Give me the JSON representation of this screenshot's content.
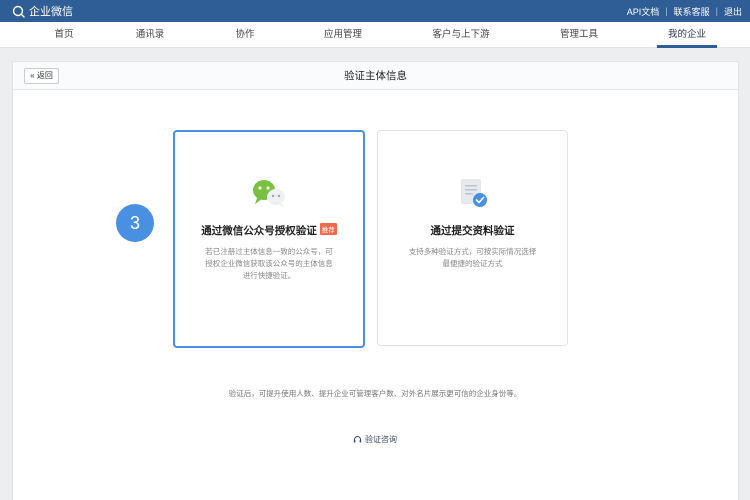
{
  "topbar": {
    "brand_name": "企业微信",
    "links": [
      "API文档",
      "联系客服",
      "退出"
    ],
    "separator": "|"
  },
  "nav": {
    "items": [
      "首页",
      "通讯录",
      "协作",
      "应用管理",
      "客户与上下游",
      "管理工具",
      "我的企业"
    ],
    "active": "我的企业"
  },
  "panel": {
    "back_label": "« 返回",
    "title": "验证主体信息"
  },
  "step_number": "3",
  "options": [
    {
      "title": "通过微信公众号授权验证",
      "badge": "推荐",
      "desc_lines": [
        "若已注册过主体信息一致的公众号，可",
        "授权企业微信获取该公众号的主体信息",
        "进行快捷验证。"
      ],
      "icon": "wechat-icon",
      "selected": true
    },
    {
      "title": "通过提交资料验证",
      "desc_lines": [
        "支持多种验证方式，可按实际情况选择",
        "最便捷的验证方式"
      ],
      "icon": "document-check-icon",
      "selected": false
    }
  ],
  "footer_note": "验证后，可提升使用人数、提升企业可管理客户数、对外名片展示更可信的企业身份等。",
  "consult_label": "验证咨询",
  "colors": {
    "topbar": "#2f5d95",
    "accent": "#4a90e2",
    "badge": "#f06b4e"
  }
}
